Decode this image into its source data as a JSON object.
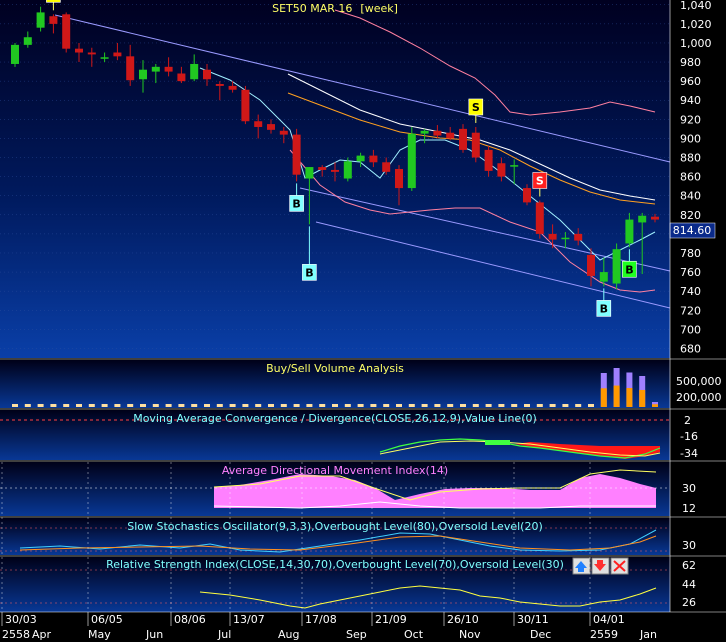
{
  "chart_data": {
    "type": "candlestick",
    "title": "SET50 MAR 16",
    "period": "[week]",
    "last_price": "814.60",
    "y_ticks": [
      1040,
      1020,
      1000,
      980,
      960,
      940,
      920,
      900,
      880,
      860,
      840,
      820,
      800,
      780,
      760,
      740,
      720,
      700,
      680
    ],
    "ylim": [
      670,
      1045
    ],
    "x_date_labels": [
      "30/03",
      "06/05",
      "08/06",
      "13/07",
      "17/08",
      "21/09",
      "26/10",
      "30/11",
      "04/01"
    ],
    "x_month_labels": [
      "2558",
      "Apr",
      "May",
      "Jun",
      "Jul",
      "Aug",
      "Sep",
      "Oct",
      "Nov",
      "Dec",
      "2559",
      "Jan"
    ],
    "candles": [
      {
        "o": 978,
        "h": 1000,
        "l": 975,
        "c": 998
      },
      {
        "o": 998,
        "h": 1012,
        "l": 995,
        "c": 1006
      },
      {
        "o": 1016,
        "h": 1038,
        "l": 1012,
        "c": 1032
      },
      {
        "o": 1028,
        "h": 1030,
        "l": 1010,
        "c": 1020
      },
      {
        "o": 1030,
        "h": 1032,
        "l": 990,
        "c": 994
      },
      {
        "o": 994,
        "h": 1000,
        "l": 980,
        "c": 990
      },
      {
        "o": 990,
        "h": 995,
        "l": 975,
        "c": 988
      },
      {
        "o": 985,
        "h": 990,
        "l": 980,
        "c": 985
      },
      {
        "o": 990,
        "h": 1000,
        "l": 982,
        "c": 986
      },
      {
        "o": 986,
        "h": 998,
        "l": 955,
        "c": 961
      },
      {
        "o": 962,
        "h": 982,
        "l": 948,
        "c": 972
      },
      {
        "o": 970,
        "h": 978,
        "l": 958,
        "c": 975
      },
      {
        "o": 975,
        "h": 985,
        "l": 965,
        "c": 970
      },
      {
        "o": 968,
        "h": 975,
        "l": 958,
        "c": 960
      },
      {
        "o": 962,
        "h": 988,
        "l": 960,
        "c": 978
      },
      {
        "o": 972,
        "h": 978,
        "l": 955,
        "c": 962
      },
      {
        "o": 957,
        "h": 960,
        "l": 940,
        "c": 955
      },
      {
        "o": 955,
        "h": 960,
        "l": 948,
        "c": 951
      },
      {
        "o": 951,
        "h": 955,
        "l": 915,
        "c": 918
      },
      {
        "o": 918,
        "h": 925,
        "l": 900,
        "c": 912
      },
      {
        "o": 915,
        "h": 920,
        "l": 905,
        "c": 909
      },
      {
        "o": 908,
        "h": 912,
        "l": 895,
        "c": 904
      },
      {
        "o": 904,
        "h": 910,
        "l": 855,
        "c": 862
      },
      {
        "o": 858,
        "h": 870,
        "l": 810,
        "c": 870
      },
      {
        "o": 870,
        "h": 872,
        "l": 860,
        "c": 867
      },
      {
        "o": 867,
        "h": 875,
        "l": 855,
        "c": 865
      },
      {
        "o": 858,
        "h": 880,
        "l": 855,
        "c": 876
      },
      {
        "o": 876,
        "h": 885,
        "l": 870,
        "c": 882
      },
      {
        "o": 882,
        "h": 888,
        "l": 870,
        "c": 875
      },
      {
        "o": 875,
        "h": 880,
        "l": 862,
        "c": 865
      },
      {
        "o": 868,
        "h": 872,
        "l": 830,
        "c": 848
      },
      {
        "o": 848,
        "h": 912,
        "l": 845,
        "c": 905
      },
      {
        "o": 905,
        "h": 910,
        "l": 895,
        "c": 908
      },
      {
        "o": 908,
        "h": 914,
        "l": 900,
        "c": 903
      },
      {
        "o": 906,
        "h": 912,
        "l": 898,
        "c": 900
      },
      {
        "o": 910,
        "h": 915,
        "l": 885,
        "c": 888
      },
      {
        "o": 906,
        "h": 912,
        "l": 875,
        "c": 880
      },
      {
        "o": 888,
        "h": 892,
        "l": 860,
        "c": 866
      },
      {
        "o": 874,
        "h": 880,
        "l": 855,
        "c": 860
      },
      {
        "o": 872,
        "h": 878,
        "l": 852,
        "c": 872
      },
      {
        "o": 848,
        "h": 852,
        "l": 830,
        "c": 833
      },
      {
        "o": 833,
        "h": 835,
        "l": 795,
        "c": 800
      },
      {
        "o": 800,
        "h": 810,
        "l": 785,
        "c": 794
      },
      {
        "o": 796,
        "h": 802,
        "l": 785,
        "c": 796
      },
      {
        "o": 800,
        "h": 806,
        "l": 788,
        "c": 793
      },
      {
        "o": 778,
        "h": 785,
        "l": 745,
        "c": 756
      },
      {
        "o": 750,
        "h": 775,
        "l": 745,
        "c": 760
      },
      {
        "o": 748,
        "h": 790,
        "l": 742,
        "c": 784
      },
      {
        "o": 790,
        "h": 822,
        "l": 786,
        "c": 815
      },
      {
        "o": 812,
        "h": 822,
        "l": 758,
        "c": 819
      },
      {
        "o": 818,
        "h": 821,
        "l": 812,
        "c": 815
      }
    ],
    "signals": [
      {
        "i": 3,
        "type": "S"
      },
      {
        "i": 22,
        "type": "B"
      },
      {
        "i": 23,
        "type": "B"
      },
      {
        "i": 36,
        "type": "S"
      },
      {
        "i": 41,
        "type": "S"
      },
      {
        "i": 46,
        "type": "B"
      },
      {
        "i": 48,
        "type": "B"
      }
    ],
    "volume": {
      "title": "Buy/Sell Volume Analysis",
      "ticks": [
        "500,000",
        "200,000"
      ],
      "values": [
        0,
        0,
        0,
        0,
        0,
        0,
        0,
        0,
        0,
        0,
        0,
        0,
        0,
        0,
        0,
        0,
        0,
        0,
        0,
        0,
        0,
        0,
        0,
        0,
        0,
        0,
        0,
        0,
        0,
        0,
        0,
        0,
        0,
        0,
        0,
        0,
        0,
        0,
        0,
        0,
        0,
        0,
        0,
        0,
        0,
        0,
        680000,
        780000,
        690000,
        620000,
        100000
      ]
    },
    "macd": {
      "title": "Moving Average Convergence / Divergence(CLOSE,26,12,9),Value Line(0)",
      "ticks": [
        "2",
        "-16",
        "-34"
      ]
    },
    "adx": {
      "title": "Average Directional Movement Index(14)",
      "ticks": [
        "30",
        "12"
      ]
    },
    "stochastic": {
      "title": "Slow Stochastics Oscillator(9,3,3),Overbought Level(80),Oversold Level(20)",
      "ticks": [
        "30"
      ]
    },
    "rsi": {
      "title": "Relative Strength Index(CLOSE,14,30,70),Overbought Level(70),Oversold Level(30)",
      "ticks": [
        "62",
        "44",
        "26"
      ]
    },
    "colors": {
      "background_top": "#00004a",
      "background_bottom": "#00309a",
      "up_candle": "#21c821",
      "down_candle": "#d01818",
      "trend_line": "#8080ff",
      "sell_marker": "#ffff00",
      "buy_marker": "#80ffff",
      "buy_marker_green": "#20ff20",
      "sell_marker_red": "#ff2020",
      "adx_fill": "#ff80ff",
      "volume_buy": "#ff9900",
      "volume_sell": "#a080ff"
    }
  }
}
